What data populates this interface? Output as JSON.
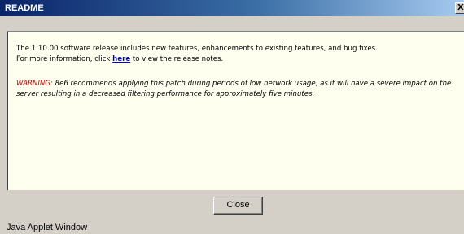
{
  "window": {
    "title": "README",
    "close_glyph": "X",
    "close_icon": "close-icon"
  },
  "content": {
    "intro_line1": "The 1.10.00 software release includes new features, enhancements to existing features, and bug fixes.",
    "intro_line2_before": "For more information, click ",
    "intro_link": "here",
    "intro_line2_after": " to view the release notes.",
    "warning_label": "WARNING:",
    "warning_text": " 8e6 recommends applying this patch during periods of low network usage, as it will have a severe impact on the server resulting in a decreased filtering performance for approximately five minutes."
  },
  "buttons": {
    "close_label": "Close"
  },
  "status": {
    "text": "Java Applet Window"
  },
  "colors": {
    "title_start": "#0a246a",
    "title_end": "#a6caf0",
    "content_bg": "#fffff0",
    "link": "#0000cc",
    "warning": "#cc0000",
    "chrome": "#d4d0c8"
  }
}
